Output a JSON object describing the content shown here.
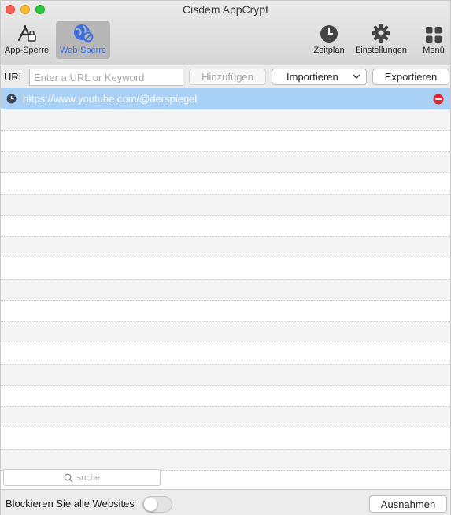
{
  "window": {
    "title": "Cisdem AppCrypt"
  },
  "toolbar": {
    "app_lock": {
      "label": "App-Sperre",
      "icon": "app-lock-icon"
    },
    "web_lock": {
      "label": "Web-Sperre",
      "icon": "globe-block-icon",
      "active": true,
      "color": "#3b6fe0"
    },
    "schedule": {
      "label": "Zeitplan",
      "icon": "clock-icon"
    },
    "settings": {
      "label": "Einstellungen",
      "icon": "gear-icon"
    },
    "menu": {
      "label": "Menü",
      "icon": "grid-icon"
    }
  },
  "urlbar": {
    "label": "URL",
    "placeholder": "Enter a URL or Keyword",
    "add_label": "Hinzufügen",
    "import_label": "Importieren",
    "export_label": "Exportieren"
  },
  "list": {
    "items": [
      {
        "url": "https://www.youtube.com/@derspiegel",
        "selected": true
      }
    ]
  },
  "search": {
    "placeholder": "suche"
  },
  "bottom": {
    "block_all_label": "Blockieren Sie alle Websites",
    "block_all_enabled": false,
    "exceptions_label": "Ausnahmen"
  },
  "colors": {
    "selection": "#a9d0f5",
    "accent": "#3b6fe0",
    "remove": "#e0242c"
  }
}
